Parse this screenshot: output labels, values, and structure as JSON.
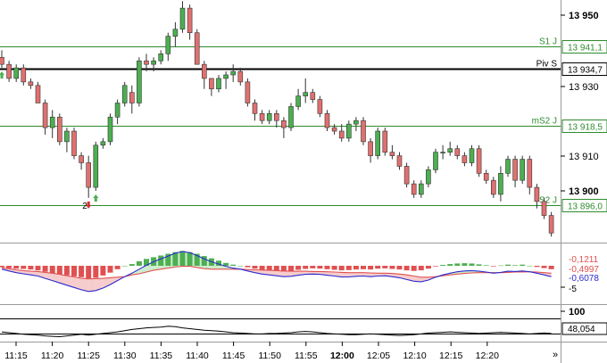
{
  "price_axis": {
    "ticks": [
      "13 950",
      "13 930",
      "13 910",
      "13 900"
    ],
    "bold_ticks": [
      "13 950",
      "13 900"
    ],
    "values": [
      13950,
      13930,
      13910,
      13900
    ]
  },
  "levels": [
    {
      "name": "S1 J",
      "value": 13941.1,
      "label": "13 941,1",
      "color": "#2e8b2e"
    },
    {
      "name": "Piv S",
      "value": 13934.7,
      "label": "13 934,7",
      "color": "#000000"
    },
    {
      "name": "mS2 J",
      "value": 13918.5,
      "label": "13 918,5",
      "color": "#2e8b2e"
    },
    {
      "name": "S2 J",
      "value": 13896.0,
      "label": "13 896,0",
      "color": "#2e8b2e"
    }
  ],
  "signal_count": "2",
  "macd": {
    "labels": [
      "-0,1211",
      "-0,4997",
      "-0,6078",
      "-5"
    ],
    "label_colors": [
      "#e05050",
      "#e05050",
      "#2a2ad0",
      "#000000"
    ]
  },
  "osc": {
    "labels": [
      "100",
      "48,054"
    ]
  },
  "time_axis": {
    "labels": [
      "11:15",
      "11:20",
      "11:25",
      "11:30",
      "11:35",
      "11:40",
      "11:45",
      "11:50",
      "11:55",
      "12:00",
      "12:05",
      "12:10",
      "12:15",
      "12:20"
    ],
    "bold": [
      "12:00"
    ],
    "scroll_icon": "»"
  },
  "colors": {
    "bull": "#4caf50",
    "bear": "#e07070",
    "support": "#2e8b2e",
    "pivot": "#000000",
    "macd_line": "#2a2ad0",
    "signal_line": "#e05050"
  },
  "chart_data": {
    "type": "candlestick",
    "interval": "1 minute",
    "columns": [
      "open",
      "high",
      "low",
      "close"
    ],
    "candles": [
      [
        13938,
        13940,
        13935,
        13936
      ],
      [
        13936,
        13937,
        13931,
        13932
      ],
      [
        13932,
        13936,
        13931,
        13935
      ],
      [
        13935,
        13936,
        13930,
        13931
      ],
      [
        13931,
        13932,
        13929,
        13930
      ],
      [
        13930,
        13931,
        13925,
        13925
      ],
      [
        13925,
        13926,
        13916,
        13918
      ],
      [
        13918,
        13923,
        13915,
        13921
      ],
      [
        13921,
        13922,
        13913,
        13914
      ],
      [
        13914,
        13918,
        13911,
        13917
      ],
      [
        13917,
        13918,
        13909,
        13910
      ],
      [
        13910,
        13911,
        13906,
        13908
      ],
      [
        13908,
        13910,
        13898,
        13901
      ],
      [
        13901,
        13914,
        13900,
        13913
      ],
      [
        13913,
        13915,
        13912,
        13914
      ],
      [
        13914,
        13922,
        13913,
        13921
      ],
      [
        13921,
        13926,
        13919,
        13925
      ],
      [
        13925,
        13931,
        13924,
        13930
      ],
      [
        13928,
        13930,
        13922,
        13925
      ],
      [
        13925,
        13938,
        13924,
        13937
      ],
      [
        13937,
        13939,
        13934,
        13936
      ],
      [
        13936,
        13938,
        13934,
        13937
      ],
      [
        13937,
        13940,
        13936,
        13939
      ],
      [
        13939,
        13945,
        13937,
        13944
      ],
      [
        13944,
        13948,
        13941,
        13946
      ],
      [
        13946,
        13954,
        13945,
        13952
      ],
      [
        13952,
        13953,
        13943,
        13945
      ],
      [
        13945,
        13946,
        13936,
        13936
      ],
      [
        13936,
        13937,
        13929,
        13932
      ],
      [
        13932,
        13932,
        13927,
        13929
      ],
      [
        13929,
        13933,
        13928,
        13932
      ],
      [
        13932,
        13934,
        13929,
        13933
      ],
      [
        13933,
        13936,
        13931,
        13934
      ],
      [
        13934,
        13935,
        13930,
        13931
      ],
      [
        13931,
        13932,
        13924,
        13925
      ],
      [
        13925,
        13926,
        13920,
        13922
      ],
      [
        13922,
        13923,
        13919,
        13920
      ],
      [
        13920,
        13923,
        13919,
        13922
      ],
      [
        13922,
        13923,
        13918,
        13920
      ],
      [
        13920,
        13921,
        13915,
        13918
      ],
      [
        13918,
        13925,
        13917,
        13924
      ],
      [
        13924,
        13929,
        13923,
        13927
      ],
      [
        13927,
        13932,
        13925,
        13928
      ],
      [
        13928,
        13929,
        13925,
        13926
      ],
      [
        13926,
        13927,
        13921,
        13922
      ],
      [
        13922,
        13923,
        13917,
        13918
      ],
      [
        13918,
        13919,
        13916,
        13917
      ],
      [
        13917,
        13919,
        13914,
        13915
      ],
      [
        13915,
        13920,
        13914,
        13919
      ],
      [
        13919,
        13921,
        13917,
        13920
      ],
      [
        13920,
        13921,
        13913,
        13914
      ],
      [
        13914,
        13915,
        13908,
        13910
      ],
      [
        13910,
        13918,
        13909,
        13917
      ],
      [
        13917,
        13918,
        13910,
        13911
      ],
      [
        13911,
        13913,
        13909,
        13910
      ],
      [
        13910,
        13911,
        13906,
        13907
      ],
      [
        13907,
        13908,
        13901,
        13902
      ],
      [
        13902,
        13903,
        13898,
        13899
      ],
      [
        13899,
        13903,
        13898,
        13902
      ],
      [
        13902,
        13907,
        13901,
        13906
      ],
      [
        13906,
        13912,
        13905,
        13911
      ],
      [
        13911,
        13913,
        13909,
        13911
      ],
      [
        13911,
        13914,
        13910,
        13912
      ],
      [
        13912,
        13913,
        13909,
        13910
      ],
      [
        13910,
        13911,
        13907,
        13908
      ],
      [
        13908,
        13913,
        13907,
        13912
      ],
      [
        13912,
        13913,
        13904,
        13905
      ],
      [
        13905,
        13906,
        13902,
        13903
      ],
      [
        13903,
        13904,
        13898,
        13899
      ],
      [
        13899,
        13907,
        13897,
        13905
      ],
      [
        13905,
        13910,
        13904,
        13909
      ],
      [
        13909,
        13910,
        13901,
        13903
      ],
      [
        13903,
        13910,
        13902,
        13909
      ],
      [
        13909,
        13910,
        13899,
        13901
      ],
      [
        13901,
        13902,
        13895,
        13897
      ],
      [
        13897,
        13898,
        13892,
        13893
      ],
      [
        13893,
        13894,
        13887,
        13888
      ]
    ],
    "signals": [
      {
        "candle": 12,
        "direction": "down"
      },
      {
        "candle": 13,
        "direction": "up"
      },
      {
        "candle": 0,
        "direction": "up"
      }
    ],
    "macd_histogram": [
      -0.5,
      -0.8,
      -1.0,
      -1.1,
      -1.3,
      -1.6,
      -2.1,
      -2.6,
      -3.0,
      -3.3,
      -3.7,
      -4.0,
      -4.4,
      -4.2,
      -3.4,
      -2.4,
      -1.2,
      0.0,
      0.6,
      1.6,
      2.4,
      3.0,
      3.6,
      4.2,
      4.8,
      5.2,
      4.8,
      4.2,
      3.4,
      2.6,
      1.8,
      1.0,
      0.4,
      0.0,
      -0.5,
      -1.0,
      -1.4,
      -1.6,
      -1.8,
      -2.0,
      -1.8,
      -1.4,
      -1.1,
      -0.9,
      -1.0,
      -1.2,
      -1.4,
      -1.6,
      -1.5,
      -1.3,
      -1.2,
      -1.3,
      -1.0,
      -0.9,
      -1.1,
      -1.3,
      -1.6,
      -1.8,
      -1.6,
      -1.0,
      -0.2,
      0.3,
      0.6,
      0.8,
      0.9,
      0.8,
      0.5,
      0.2,
      -0.2,
      0.1,
      0.4,
      0.2,
      0.4,
      0.0,
      -0.4,
      -0.8,
      -1.2
    ],
    "macd_line": [
      -1.2,
      -1.8,
      -2.4,
      -2.8,
      -3.2,
      -3.6,
      -4.4,
      -5.2,
      -6.0,
      -6.8,
      -7.6,
      -8.4,
      -9.0,
      -8.7,
      -7.8,
      -6.6,
      -5.2,
      -3.8,
      -2.6,
      -1.2,
      0.2,
      1.4,
      2.4,
      3.4,
      4.4,
      5.0,
      4.6,
      3.6,
      2.4,
      1.4,
      0.6,
      -0.2,
      -0.8,
      -1.2,
      -1.8,
      -2.4,
      -2.9,
      -3.2,
      -3.5,
      -3.8,
      -3.7,
      -3.3,
      -3.0,
      -2.9,
      -3.0,
      -3.3,
      -3.6,
      -3.9,
      -3.9,
      -3.7,
      -3.6,
      -3.8,
      -3.6,
      -3.5,
      -3.8,
      -4.2,
      -4.8,
      -5.4,
      -5.6,
      -5.0,
      -4.0,
      -3.2,
      -2.6,
      -2.1,
      -1.8,
      -1.7,
      -1.9,
      -2.2,
      -2.6,
      -2.3,
      -1.9,
      -2.0,
      -1.8,
      -2.1,
      -2.6,
      -3.2,
      -3.8
    ],
    "signal_line": [
      -0.7,
      -1.0,
      -1.4,
      -1.7,
      -1.9,
      -2.0,
      -2.3,
      -2.6,
      -3.0,
      -3.5,
      -3.9,
      -4.4,
      -4.6,
      -4.5,
      -4.4,
      -4.2,
      -4.0,
      -3.8,
      -3.2,
      -2.8,
      -2.2,
      -1.6,
      -1.2,
      -0.8,
      -0.4,
      -0.2,
      -0.2,
      -0.6,
      -1.0,
      -1.2,
      -1.2,
      -1.2,
      -1.2,
      -1.2,
      -1.3,
      -1.4,
      -1.5,
      -1.6,
      -1.7,
      -1.8,
      -1.9,
      -1.9,
      -1.9,
      -2.0,
      -2.0,
      -2.1,
      -2.2,
      -2.3,
      -2.4,
      -2.4,
      -2.4,
      -2.5,
      -2.6,
      -2.6,
      -2.7,
      -2.9,
      -3.2,
      -3.6,
      -4.0,
      -4.0,
      -3.8,
      -3.5,
      -3.2,
      -2.9,
      -2.7,
      -2.5,
      -2.4,
      -2.4,
      -2.4,
      -2.4,
      -2.3,
      -2.2,
      -2.2,
      -2.1,
      -2.2,
      -2.4,
      -2.6
    ],
    "osc_line": [
      52,
      50,
      48,
      46,
      45,
      44,
      42,
      41,
      40,
      42,
      44,
      46,
      44,
      46,
      48,
      50,
      52,
      55,
      58,
      60,
      62,
      63,
      64,
      66,
      65,
      62,
      60,
      58,
      56,
      55,
      54,
      52,
      50,
      49,
      48,
      47,
      47,
      48,
      48,
      49,
      50,
      52,
      53,
      52,
      50,
      48,
      47,
      46,
      45,
      45,
      46,
      47,
      46,
      45,
      44,
      43,
      44,
      45,
      47,
      49,
      50,
      51,
      52,
      51,
      50,
      49,
      48,
      49,
      50,
      51,
      50,
      49,
      48,
      47,
      48,
      49,
      48
    ]
  }
}
